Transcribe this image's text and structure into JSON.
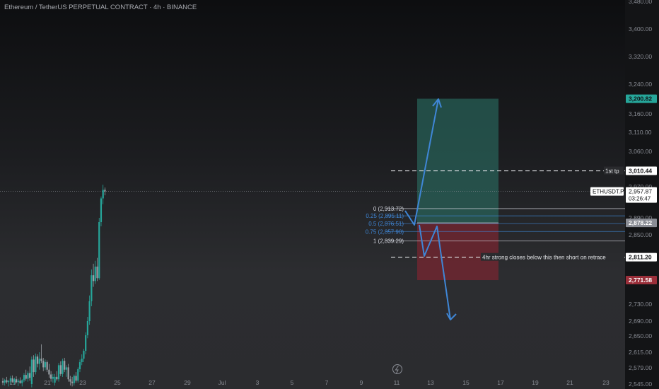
{
  "header": {
    "title": "Ethereum / TetherUS PERPETUAL CONTRACT · 4h · BINANCE"
  },
  "colors": {
    "up": "#26a69a",
    "down": "#9aa0a6",
    "profit_zone": "#2a6e62",
    "loss_zone": "#7a2530",
    "arrow": "#3f86d6",
    "fib_line": "#d1d4dc",
    "fib_mid": "#3f86d6",
    "badge_tp": "#26a69a",
    "badge_sl": "#9a2f3a"
  },
  "icons": {
    "replay": "lightning-icon"
  },
  "chart_data": {
    "type": "candlestick",
    "symbol": "ETHUSDT.P",
    "timeframe": "4h",
    "y_ticks": [
      3480,
      3400,
      3320,
      3240,
      3160,
      3110,
      3060,
      2970,
      2890,
      2850,
      2730,
      2690,
      2650,
      2615,
      2579,
      2545
    ],
    "y_tick_labels": [
      "3,480.00",
      "3,400.00",
      "3,320.00",
      "3,240.00",
      "3,160.00",
      "3,110.00",
      "3,060.00",
      "2,970.00",
      "2,890.00",
      "2,850.00",
      "2,730.00",
      "2,690.00",
      "2,650.00",
      "2,615.00",
      "2,579.00",
      "2,545.00"
    ],
    "x_ticks": [
      "19",
      "21",
      "23",
      "25",
      "27",
      "29",
      "Jul",
      "3",
      "5",
      "7",
      "9",
      "11",
      "13",
      "15",
      "17",
      "19",
      "21",
      "23"
    ],
    "candles": [
      {
        "o": 2551,
        "h": 2558,
        "l": 2543,
        "c": 2548
      },
      {
        "o": 2548,
        "h": 2556,
        "l": 2542,
        "c": 2553
      },
      {
        "o": 2553,
        "h": 2560,
        "l": 2546,
        "c": 2549
      },
      {
        "o": 2549,
        "h": 2554,
        "l": 2540,
        "c": 2551
      },
      {
        "o": 2551,
        "h": 2562,
        "l": 2545,
        "c": 2557
      },
      {
        "o": 2557,
        "h": 2563,
        "l": 2548,
        "c": 2550
      },
      {
        "o": 2550,
        "h": 2558,
        "l": 2544,
        "c": 2555
      },
      {
        "o": 2555,
        "h": 2561,
        "l": 2547,
        "c": 2549
      },
      {
        "o": 2549,
        "h": 2556,
        "l": 2541,
        "c": 2552
      },
      {
        "o": 2552,
        "h": 2559,
        "l": 2546,
        "c": 2547
      },
      {
        "o": 2547,
        "h": 2555,
        "l": 2540,
        "c": 2553
      },
      {
        "o": 2553,
        "h": 2568,
        "l": 2549,
        "c": 2564
      },
      {
        "o": 2564,
        "h": 2575,
        "l": 2552,
        "c": 2556
      },
      {
        "o": 2556,
        "h": 2572,
        "l": 2550,
        "c": 2568
      },
      {
        "o": 2568,
        "h": 2582,
        "l": 2552,
        "c": 2558
      },
      {
        "o": 2545,
        "h": 2605,
        "l": 2538,
        "c": 2598
      },
      {
        "o": 2598,
        "h": 2608,
        "l": 2560,
        "c": 2570
      },
      {
        "o": 2570,
        "h": 2612,
        "l": 2565,
        "c": 2605
      },
      {
        "o": 2605,
        "h": 2610,
        "l": 2580,
        "c": 2588
      },
      {
        "o": 2588,
        "h": 2615,
        "l": 2575,
        "c": 2600
      },
      {
        "o": 2600,
        "h": 2632,
        "l": 2590,
        "c": 2595
      },
      {
        "o": 2595,
        "h": 2602,
        "l": 2572,
        "c": 2580
      },
      {
        "o": 2580,
        "h": 2598,
        "l": 2574,
        "c": 2592
      },
      {
        "o": 2592,
        "h": 2596,
        "l": 2570,
        "c": 2575
      },
      {
        "o": 2575,
        "h": 2588,
        "l": 2558,
        "c": 2565
      },
      {
        "o": 2565,
        "h": 2572,
        "l": 2550,
        "c": 2556
      },
      {
        "o": 2556,
        "h": 2566,
        "l": 2548,
        "c": 2560
      },
      {
        "o": 2548,
        "h": 2566,
        "l": 2542,
        "c": 2560
      },
      {
        "o": 2560,
        "h": 2572,
        "l": 2552,
        "c": 2555
      },
      {
        "o": 2555,
        "h": 2590,
        "l": 2550,
        "c": 2585
      },
      {
        "o": 2585,
        "h": 2594,
        "l": 2562,
        "c": 2566
      },
      {
        "o": 2566,
        "h": 2600,
        "l": 2560,
        "c": 2595
      },
      {
        "o": 2595,
        "h": 2602,
        "l": 2570,
        "c": 2575
      },
      {
        "o": 2575,
        "h": 2585,
        "l": 2560,
        "c": 2580
      },
      {
        "o": 2580,
        "h": 2588,
        "l": 2550,
        "c": 2555
      },
      {
        "o": 2555,
        "h": 2562,
        "l": 2542,
        "c": 2550
      },
      {
        "o": 2550,
        "h": 2560,
        "l": 2540,
        "c": 2547
      },
      {
        "o": 2547,
        "h": 2565,
        "l": 2542,
        "c": 2562
      },
      {
        "o": 2562,
        "h": 2570,
        "l": 2548,
        "c": 2552
      },
      {
        "o": 2552,
        "h": 2580,
        "l": 2548,
        "c": 2576
      },
      {
        "o": 2576,
        "h": 2598,
        "l": 2570,
        "c": 2592
      },
      {
        "o": 2592,
        "h": 2610,
        "l": 2585,
        "c": 2600
      },
      {
        "o": 2600,
        "h": 2622,
        "l": 2592,
        "c": 2618
      },
      {
        "o": 2618,
        "h": 2660,
        "l": 2610,
        "c": 2652
      },
      {
        "o": 2652,
        "h": 2700,
        "l": 2645,
        "c": 2690
      },
      {
        "o": 2690,
        "h": 2745,
        "l": 2680,
        "c": 2735
      },
      {
        "o": 2735,
        "h": 2790,
        "l": 2725,
        "c": 2780
      },
      {
        "o": 2780,
        "h": 2800,
        "l": 2760,
        "c": 2770
      },
      {
        "o": 2770,
        "h": 2805,
        "l": 2765,
        "c": 2795
      },
      {
        "o": 2795,
        "h": 2810,
        "l": 2770,
        "c": 2775
      },
      {
        "o": 2775,
        "h": 2890,
        "l": 2772,
        "c": 2880
      },
      {
        "o": 2880,
        "h": 2945,
        "l": 2870,
        "c": 2940
      },
      {
        "o": 2940,
        "h": 2975,
        "l": 2925,
        "c": 2962
      },
      {
        "o": 2962,
        "h": 2968,
        "l": 2948,
        "c": 2958
      }
    ],
    "last_price": {
      "label": "ETHUSDT.P",
      "price": "2,957.87",
      "countdown": "03:26:47",
      "value": 2957.87
    },
    "fib_levels": [
      {
        "label": "0 (2,913.72)",
        "value": 2913.72
      },
      {
        "label": "0.25 (2,895.11)",
        "value": 2895.11
      },
      {
        "label": "0.5 (2,876.51)",
        "value": 2876.51
      },
      {
        "label": "0.75 (2,857.90)",
        "value": 2857.9
      },
      {
        "label": "1 (2,839.29)",
        "value": 2839.29
      }
    ],
    "position": {
      "entry": 2878.22,
      "entry_label": "2,878.22",
      "target": 3200.82,
      "target_label": "3,200.82",
      "stop": 2771.58,
      "stop_label": "2,771.58"
    },
    "annotations": [
      {
        "text": "1st tp",
        "price": 3010.44,
        "price_label": "3,010.44"
      },
      {
        "text": "4hr strong closes below this then short on retrace",
        "price": 2811.2,
        "price_label": "2,811.20"
      }
    ]
  }
}
